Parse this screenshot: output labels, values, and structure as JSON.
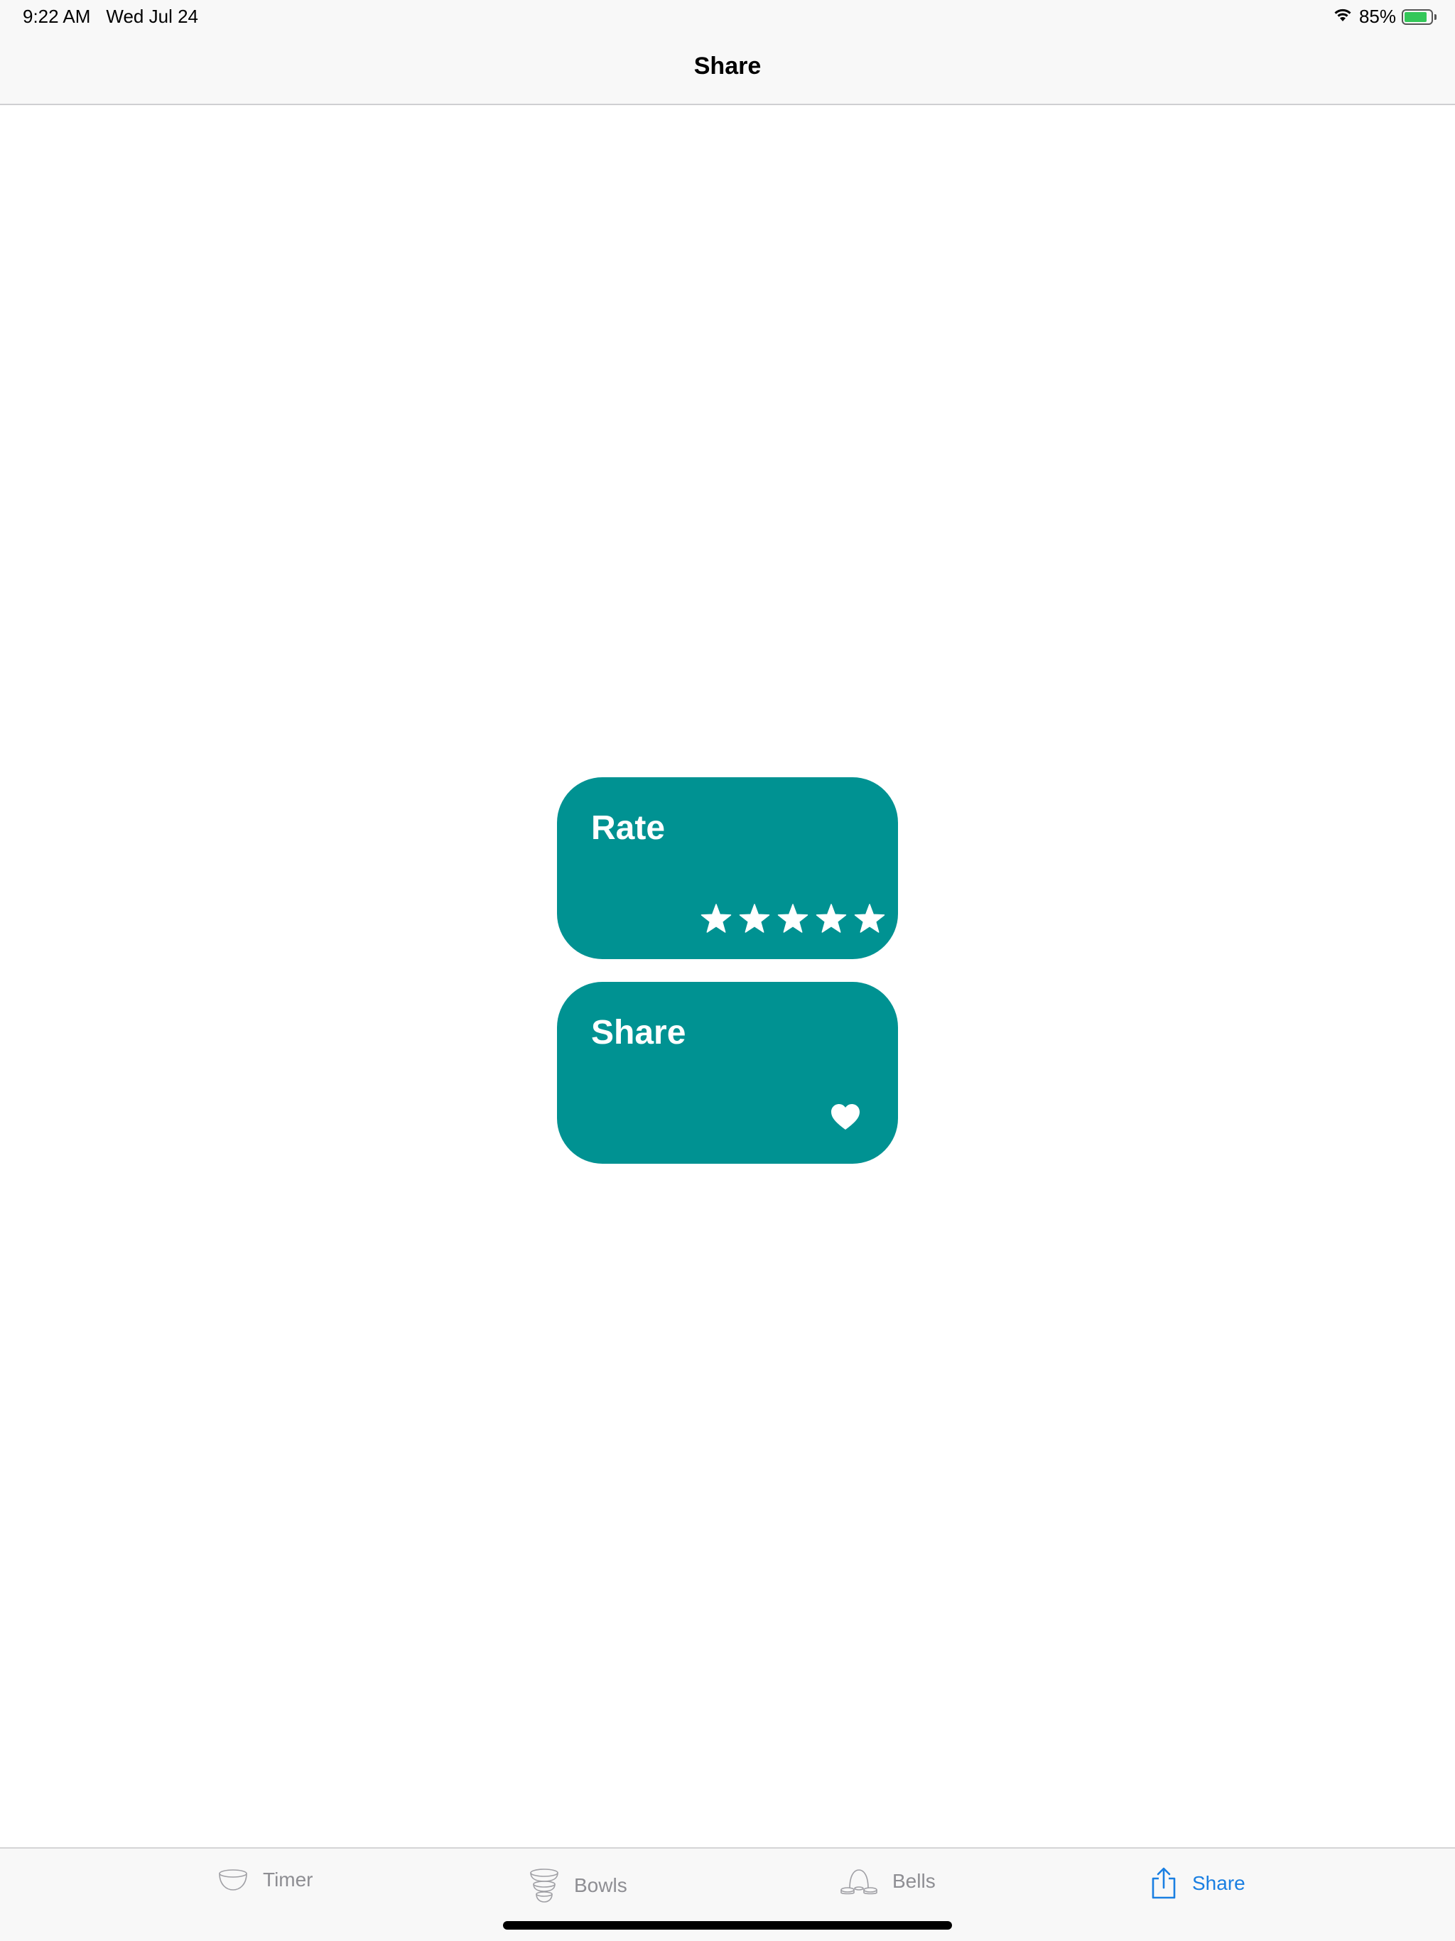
{
  "status_bar": {
    "time": "9:22 AM",
    "date": "Wed Jul 24",
    "battery_percent": "85%",
    "battery_level": 0.85,
    "battery_color": "#34c759",
    "icons": [
      "wifi-icon",
      "battery-charging-icon"
    ]
  },
  "nav": {
    "title": "Share"
  },
  "cards": {
    "accent_color": "#009292",
    "rate": {
      "title": "Rate",
      "rating": 5,
      "rating_max": 5,
      "icon": "star-icon"
    },
    "share": {
      "title": "Share",
      "icon": "heart-icon"
    }
  },
  "tab_bar": {
    "selected_color": "#1a7fe2",
    "items": [
      {
        "label": "Timer",
        "icon": "bowl-icon",
        "selected": false
      },
      {
        "label": "Bowls",
        "icon": "stacked-bowls-icon",
        "selected": false
      },
      {
        "label": "Bells",
        "icon": "bells-icon",
        "selected": false
      },
      {
        "label": "Share",
        "icon": "share-icon",
        "selected": true
      }
    ]
  }
}
